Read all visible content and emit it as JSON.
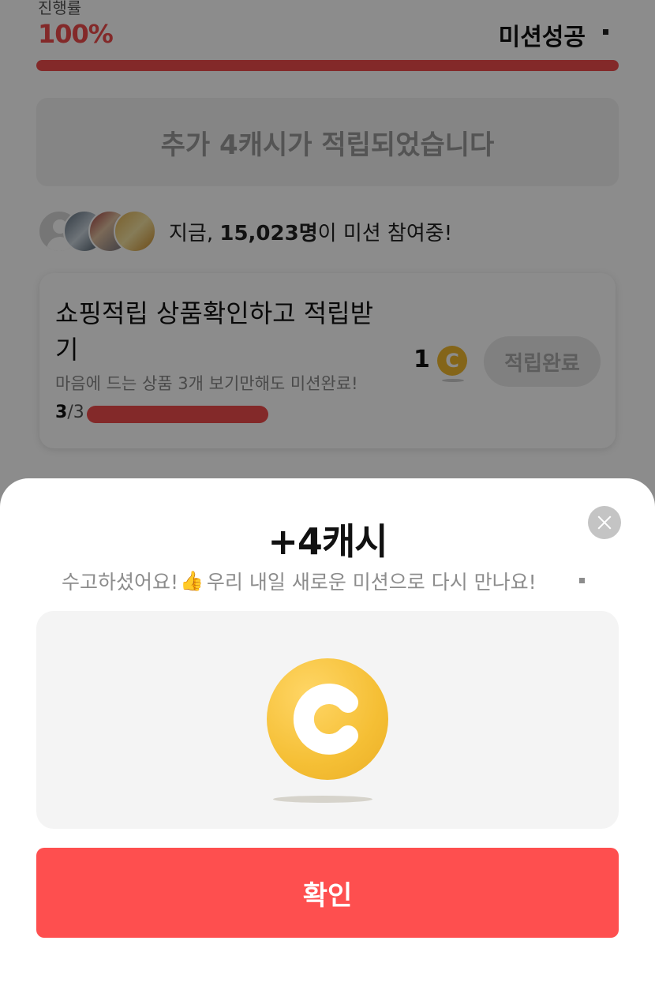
{
  "progress": {
    "label": "진행률",
    "value_text": "100%",
    "value_fraction": 1.0,
    "status": "미션성공"
  },
  "banner": {
    "text": "추가 4캐시가 적립되었습니다"
  },
  "participants": {
    "prefix": "지금, ",
    "count": "15,023명",
    "suffix": "이 미션 참여중!"
  },
  "mission": {
    "title": "쇼핑적립 상품확인하고 적립받기",
    "description": "마음에 드는 상품 3개 보기만해도 미션완료!",
    "done": "3",
    "total": "/3",
    "reward": "1",
    "coin_letter": "C",
    "button_label": "적립완료"
  },
  "sheet": {
    "title": "+4캐시",
    "subtitle_before": "수고하셨어요!",
    "subtitle_after": " 우리 내일 새로운 미션으로 다시 만나요!",
    "confirm_label": "확인"
  },
  "colors": {
    "accent": "#fe4f4f",
    "coin": "#f5bf35"
  },
  "icons": {
    "close": "close-icon",
    "thumbs": "thumbs-up-icon",
    "coin": "cash-coin-icon"
  }
}
